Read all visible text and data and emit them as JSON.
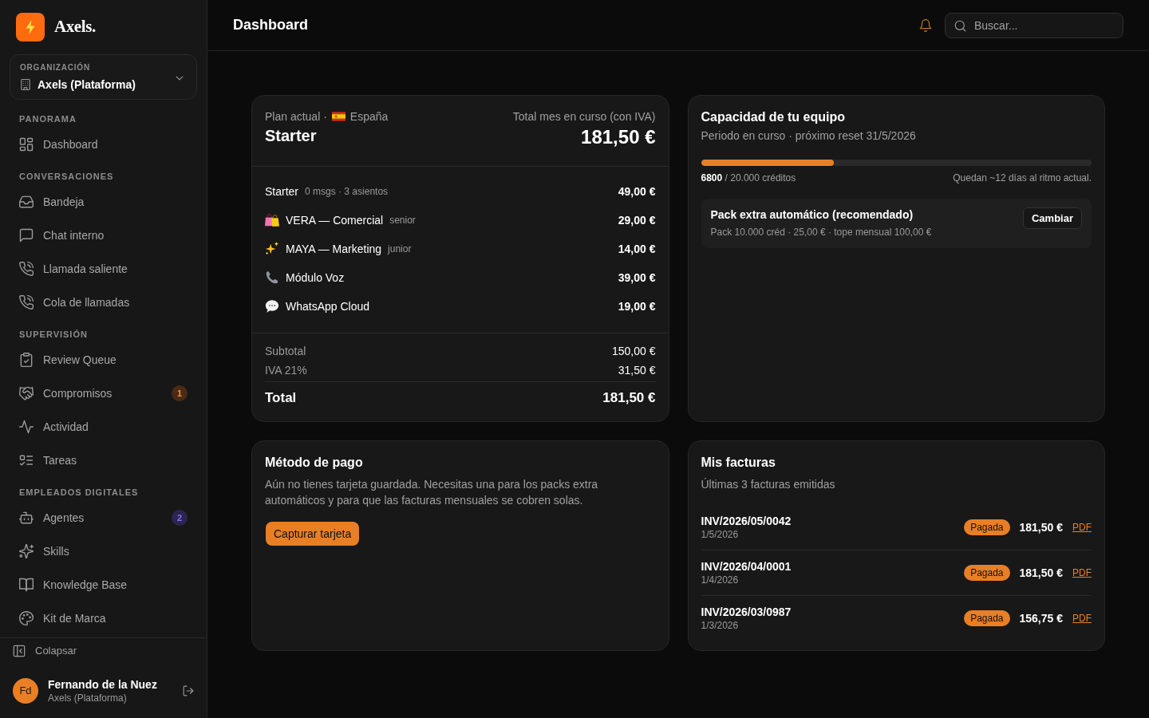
{
  "sidebar": {
    "logo": {
      "text": "Axels."
    },
    "organization": {
      "label": "ORGANIZACIÓN",
      "name": "Axels (Plataforma)"
    },
    "sections": [
      {
        "title": "PANORAMA",
        "items": [
          {
            "label": "Dashboard"
          }
        ]
      },
      {
        "title": "CONVERSACIONES",
        "items": [
          {
            "label": "Bandeja"
          },
          {
            "label": "Chat interno"
          },
          {
            "label": "Llamada saliente"
          },
          {
            "label": "Cola de llamadas"
          }
        ]
      },
      {
        "title": "SUPERVISIÓN",
        "items": [
          {
            "label": "Review Queue"
          },
          {
            "label": "Compromisos",
            "badge": {
              "text": "1",
              "color": "#4a2b15"
            }
          },
          {
            "label": "Actividad"
          },
          {
            "label": "Tareas"
          }
        ]
      },
      {
        "title": "EMPLEADOS DIGITALES",
        "items": [
          {
            "label": "Agentes",
            "badge": {
              "text": "2",
              "color": "#2d2550"
            }
          },
          {
            "label": "Skills"
          },
          {
            "label": "Knowledge Base"
          },
          {
            "label": "Kit de Marca"
          }
        ]
      }
    ],
    "collapse": "Colapsar",
    "user": {
      "initials": "Fd",
      "name": "Fernando de la Nuez",
      "organization": "Axels (Plataforma)"
    }
  },
  "header": {
    "title": "Dashboard",
    "search": {
      "placeholder": "Buscar..."
    }
  },
  "plan": {
    "caption": "Plan actual ·",
    "country": "España",
    "name": "Starter",
    "total_label": "Total mes en curso (con IVA)",
    "total": "181,50 €",
    "lines": [
      {
        "label": "Starter",
        "note": "0 msgs · 3 asientos",
        "amount": "49,00 €"
      },
      {
        "label": "VERA — Comercial",
        "note": "senior",
        "amount": "29,00 €"
      },
      {
        "label": "MAYA — Marketing",
        "note": "junior",
        "amount": "14,00 €"
      },
      {
        "label": "Módulo Voz",
        "amount": "39,00 €"
      },
      {
        "label": "WhatsApp Cloud",
        "amount": "19,00 €"
      }
    ],
    "totals": [
      {
        "label": "Subtotal",
        "amount": "150,00 €"
      },
      {
        "label": "IVA 21%",
        "amount": "31,50 €"
      }
    ],
    "grand_total": {
      "label": "Total",
      "amount": "181,50 €"
    }
  },
  "capacity": {
    "title": "Capacidad de tu equipo",
    "subtitle": "Periodo en curso · próximo reset 31/5/2026",
    "usage": {
      "level": 0.34,
      "summary": "**6800** / 20.000 créditos"
    },
    "forecast": "Quedan ~12 días al ritmo actual.",
    "pack": {
      "title": "Pack extra automático (recomendado)",
      "details": "Pack 10.000 créd · 25,00 € · tope mensual 100,00 €",
      "button": "Cambiar"
    }
  },
  "payment": {
    "title": "Método de pago",
    "message": "Aún no tienes tarjeta guardada. Necesitas una para los packs extra automáticos y para que las facturas mensuales se cobren solas.",
    "button": "Capturar tarjeta"
  },
  "invoices": {
    "title": "Mis facturas",
    "subtitle": "Últimas 3 facturas emitidas",
    "rows": [
      {
        "number": "INV/2026/05/0042",
        "date": "1/5/2026",
        "status": "Pagada",
        "amount": "181,50 €",
        "link": "PDF"
      },
      {
        "number": "INV/2026/04/0001",
        "date": "1/4/2026",
        "status": "Pagada",
        "amount": "181,50 €",
        "link": "PDF"
      },
      {
        "number": "INV/2026/03/0987",
        "date": "1/3/2026",
        "status": "Pagada",
        "amount": "156,75 €",
        "link": "PDF"
      }
    ]
  }
}
